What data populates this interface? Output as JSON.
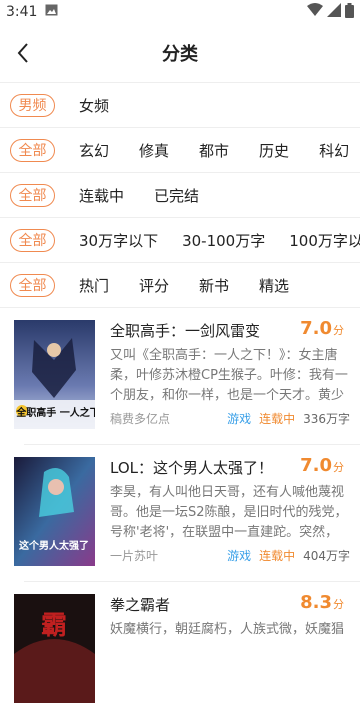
{
  "status_bar": {
    "time": "3:41"
  },
  "header": {
    "title": "分类"
  },
  "filters": {
    "gender": {
      "selected": "男频",
      "options": [
        "女频"
      ]
    },
    "category": {
      "selected": "全部",
      "options": [
        "玄幻",
        "修真",
        "都市",
        "历史",
        "科幻"
      ]
    },
    "status": {
      "selected": "全部",
      "options": [
        "连载中",
        "已完结"
      ]
    },
    "words": {
      "selected": "全部",
      "options": [
        "30万字以下",
        "30-100万字",
        "100万字以上"
      ]
    },
    "sort": {
      "selected": "全部",
      "options": [
        "热门",
        "评分",
        "新书",
        "精选"
      ]
    }
  },
  "books": [
    {
      "title": "全职高手：一剑风雷变",
      "score": "7.0",
      "score_unit": "分",
      "description": "又叫《全职高手：一人之下！》：女主唐柔，叶修苏沐橙CP生猴子。叶修：我有一个朋友，和你一样，也是一个天才。黄少天...",
      "author": "稿费多亿点",
      "genre": "游戏",
      "status": "连载中",
      "words": "336万字",
      "cover_text": "全职高手 一人之下"
    },
    {
      "title": "LOL：这个男人太强了！",
      "score": "7.0",
      "score_unit": "分",
      "description": "李昊，有人叫他日天哥，还有人喊他蔑视哥。他是一坛S2陈酿，是旧时代的残党，号称'老将'，在联盟中一直建跎。突然，他有挂...",
      "author": "一片苏叶",
      "genre": "游戏",
      "status": "连载中",
      "words": "404万字",
      "cover_text": "这个男人太强了"
    },
    {
      "title": "拳之霸者",
      "score": "8.3",
      "score_unit": "分",
      "description": "妖魔横行，朝廷腐朽，人族式微，妖魔猖",
      "author": "",
      "genre": "",
      "status": "",
      "words": "",
      "cover_text": "霸"
    }
  ]
}
